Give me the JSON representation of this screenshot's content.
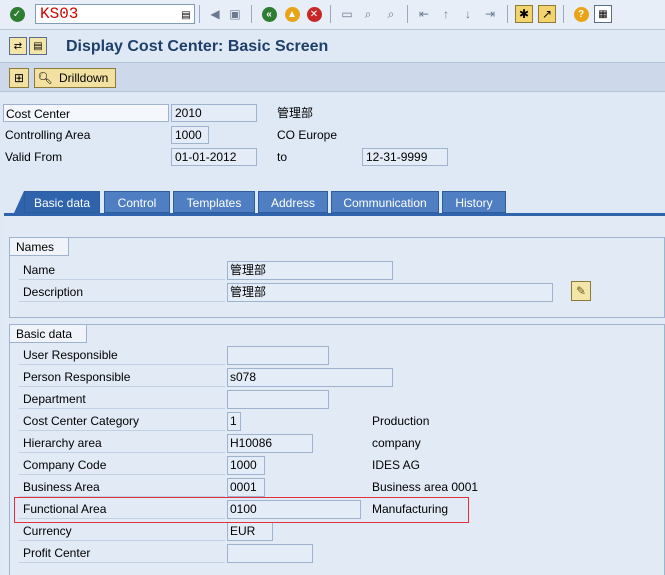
{
  "toolbar": {
    "command_field": "KS03",
    "icons": [
      "enter-icon",
      "save-icon",
      "back-icon",
      "exit-icon",
      "cancel-icon",
      "print-icon",
      "find-icon",
      "find-next-icon",
      "first-page-icon",
      "previous-page-icon",
      "next-page-icon",
      "last-page-icon",
      "create-session-icon",
      "shortcut-icon",
      "help-icon",
      "customize-layout-icon"
    ]
  },
  "title": "Display Cost Center: Basic Screen",
  "app_toolbar": {
    "drilldown_label": "Drilldown"
  },
  "header": {
    "cost_center_label": "Cost Center",
    "cost_center_value": "2010",
    "cost_center_desc": "管理部",
    "controlling_area_label": "Controlling Area",
    "controlling_area_value": "1000",
    "controlling_area_desc": "CO Europe",
    "valid_from_label": "Valid From",
    "valid_from_value": "01-01-2012",
    "to_label": "to",
    "valid_to_value": "12-31-9999"
  },
  "tabs": [
    {
      "label": "Basic data",
      "active": true
    },
    {
      "label": "Control",
      "active": false
    },
    {
      "label": "Templates",
      "active": false
    },
    {
      "label": "Address",
      "active": false
    },
    {
      "label": "Communication",
      "active": false
    },
    {
      "label": "History",
      "active": false
    }
  ],
  "names_group": {
    "title": "Names",
    "name_label": "Name",
    "name_value": "管理部",
    "description_label": "Description",
    "description_value": "管理部"
  },
  "basic_group": {
    "title": "Basic data",
    "user_responsible_label": "User Responsible",
    "user_responsible_value": "",
    "person_responsible_label": "Person Responsible",
    "person_responsible_value": "s078",
    "department_label": "Department",
    "department_value": "",
    "category_label": "Cost Center Category",
    "category_value": "1",
    "category_desc": "Production",
    "hierarchy_label": "Hierarchy area",
    "hierarchy_value": "H10086",
    "hierarchy_desc": "company",
    "company_code_label": "Company Code",
    "company_code_value": "1000",
    "company_code_desc": "IDES AG",
    "business_area_label": "Business Area",
    "business_area_value": "0001",
    "business_area_desc": "Business area 0001",
    "functional_area_label": "Functional Area",
    "functional_area_value": "0100",
    "functional_area_desc": "Manufacturing",
    "currency_label": "Currency",
    "currency_value": "EUR",
    "profit_center_label": "Profit Center",
    "profit_center_value": ""
  },
  "colors": {
    "title_blue": "#1f3f6b",
    "tab_blue": "#2f64ad",
    "highlight_red": "#e0323c",
    "command_red": "#d40000"
  }
}
